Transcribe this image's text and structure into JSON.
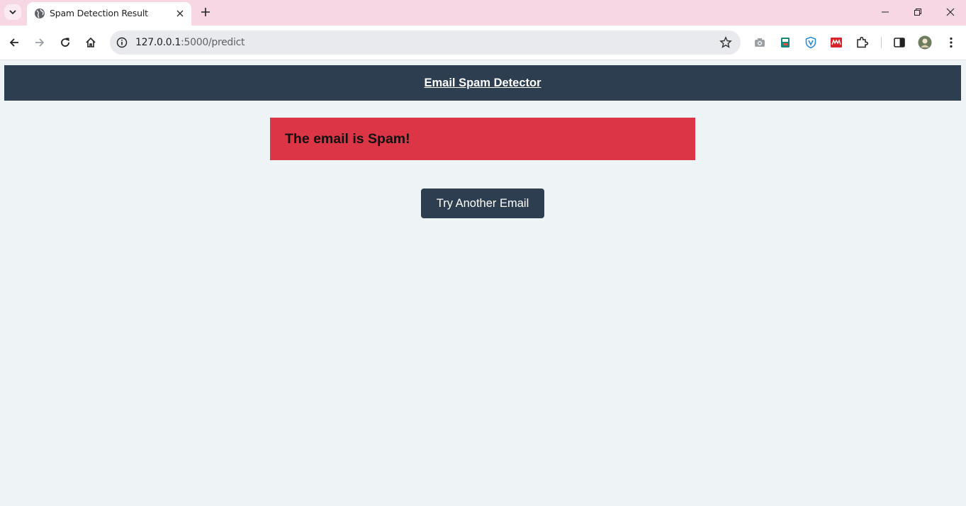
{
  "browser": {
    "tab_title": "Spam Detection Result",
    "url_host": "127.0.0.1",
    "url_path": ":5000/predict",
    "extensions": [
      "camera-icon",
      "book-icon",
      "shield-icon",
      "grid-icon",
      "puzzle-icon"
    ],
    "toolbar_icons": [
      "back-icon",
      "forward-icon",
      "reload-icon",
      "home-icon"
    ],
    "window_controls": [
      "minimize-icon",
      "restore-icon",
      "close-icon"
    ]
  },
  "page": {
    "header_title": "Email Spam Detector",
    "result_text": "The email is Spam!",
    "try_button_label": "Try Another Email"
  },
  "colors": {
    "header_bg": "#2c3e50",
    "result_bg": "#dc3545",
    "button_bg": "#2c3e50",
    "page_bg": "#eef3f6",
    "tabbar_bg": "#f6d7e3"
  }
}
